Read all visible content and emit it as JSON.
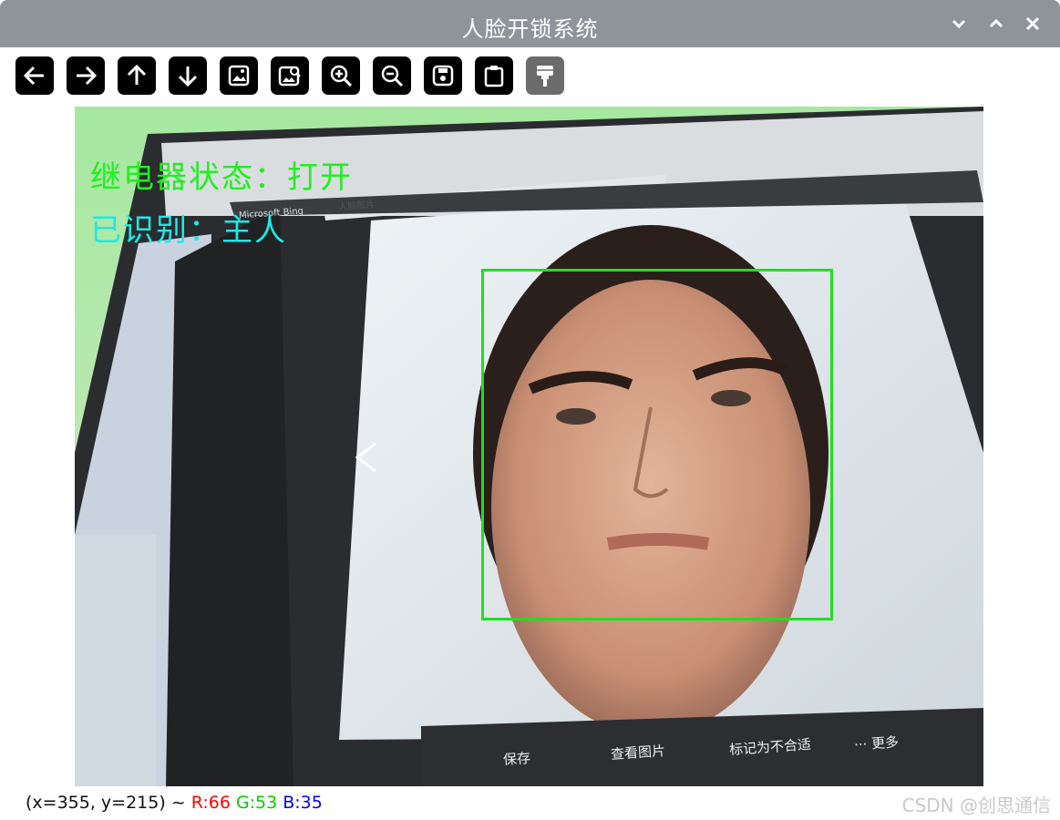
{
  "window": {
    "title": "人脸开锁系统"
  },
  "toolbar": {
    "buttons": [
      {
        "name": "back-button",
        "icon": "arrow-left-icon"
      },
      {
        "name": "forward-button",
        "icon": "arrow-right-icon"
      },
      {
        "name": "up-button",
        "icon": "arrow-up-icon"
      },
      {
        "name": "down-button",
        "icon": "arrow-down-icon"
      },
      {
        "name": "image-button",
        "icon": "image-icon"
      },
      {
        "name": "image-search-button",
        "icon": "image-zoom-icon"
      },
      {
        "name": "zoom-in-button",
        "icon": "zoom-in-icon"
      },
      {
        "name": "zoom-out-button",
        "icon": "zoom-out-icon"
      },
      {
        "name": "save-button",
        "icon": "save-icon"
      },
      {
        "name": "clipboard-button",
        "icon": "clipboard-icon"
      },
      {
        "name": "properties-button",
        "icon": "brush-icon"
      }
    ]
  },
  "overlay": {
    "relay_status": "继电器状态：打开",
    "recognized": "已识别：主人"
  },
  "camera_scene": {
    "bing_search_placeholder": "人脸图片",
    "bing_logo": "Microsoft Bing",
    "actions": [
      "保存",
      "查看图片",
      "标记为不合适",
      "··· 更多"
    ],
    "prev_arrow": "‹"
  },
  "status_bar": {
    "coords": "(x=355, y=215) ~",
    "r": "R:66",
    "g": "G:53",
    "b": "B:35"
  },
  "watermark": "CSDN @创思通信",
  "colors": {
    "relay_text": "#1ef01e",
    "recognized_text": "#1ee8e8",
    "face_box": "#1ee01e",
    "r": "#ff0000",
    "g": "#00cc00",
    "b": "#0000ff"
  }
}
